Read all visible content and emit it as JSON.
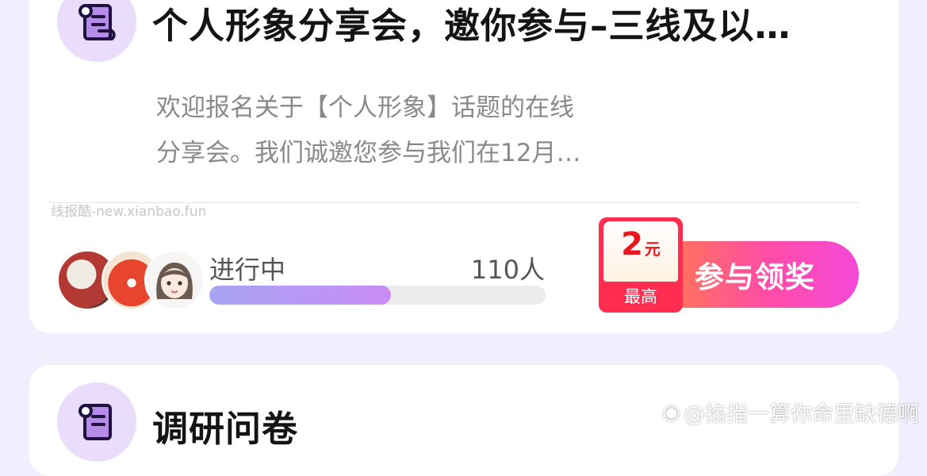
{
  "card1": {
    "title": "个人形象分享会，邀你参与–三线及以…",
    "desc_line1": "欢迎报名关于【个人形象】话题的在线",
    "desc_line2": "分享会。我们诚邀您参与我们在12月…",
    "status": "进行中",
    "participants": "110人",
    "progress_fraction": 0.54,
    "reward": {
      "amount": "2",
      "unit": "元",
      "label": "最高"
    },
    "button_label": "参与领奖"
  },
  "card2": {
    "title": "调研问卷"
  },
  "watermarks": {
    "top": "线报酷-new.xianbao.fun",
    "bottom": "@掐指一算你命里缺德啊"
  },
  "icons": {
    "card_icon": "scroll-icon",
    "weibo_icon": "weibo-icon"
  },
  "colors": {
    "accent_purple": "#6c31b8",
    "button_pink": "#ff4da6",
    "reward_red": "#ff2d4f"
  }
}
